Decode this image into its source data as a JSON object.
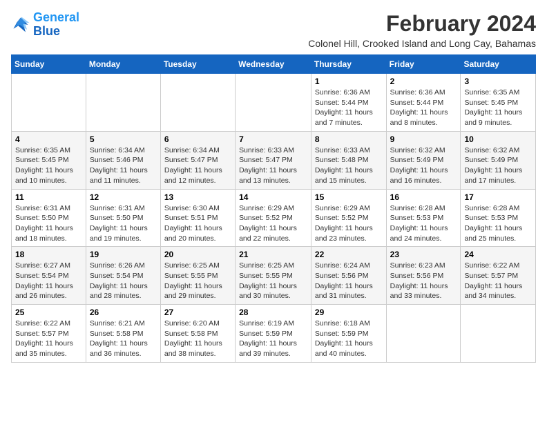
{
  "logo": {
    "line1": "General",
    "line2": "Blue"
  },
  "title": "February 2024",
  "subtitle": "Colonel Hill, Crooked Island and Long Cay, Bahamas",
  "days_of_week": [
    "Sunday",
    "Monday",
    "Tuesday",
    "Wednesday",
    "Thursday",
    "Friday",
    "Saturday"
  ],
  "weeks": [
    [
      {
        "day": "",
        "info": ""
      },
      {
        "day": "",
        "info": ""
      },
      {
        "day": "",
        "info": ""
      },
      {
        "day": "",
        "info": ""
      },
      {
        "day": "1",
        "info": "Sunrise: 6:36 AM\nSunset: 5:44 PM\nDaylight: 11 hours and 7 minutes."
      },
      {
        "day": "2",
        "info": "Sunrise: 6:36 AM\nSunset: 5:44 PM\nDaylight: 11 hours and 8 minutes."
      },
      {
        "day": "3",
        "info": "Sunrise: 6:35 AM\nSunset: 5:45 PM\nDaylight: 11 hours and 9 minutes."
      }
    ],
    [
      {
        "day": "4",
        "info": "Sunrise: 6:35 AM\nSunset: 5:45 PM\nDaylight: 11 hours and 10 minutes."
      },
      {
        "day": "5",
        "info": "Sunrise: 6:34 AM\nSunset: 5:46 PM\nDaylight: 11 hours and 11 minutes."
      },
      {
        "day": "6",
        "info": "Sunrise: 6:34 AM\nSunset: 5:47 PM\nDaylight: 11 hours and 12 minutes."
      },
      {
        "day": "7",
        "info": "Sunrise: 6:33 AM\nSunset: 5:47 PM\nDaylight: 11 hours and 13 minutes."
      },
      {
        "day": "8",
        "info": "Sunrise: 6:33 AM\nSunset: 5:48 PM\nDaylight: 11 hours and 15 minutes."
      },
      {
        "day": "9",
        "info": "Sunrise: 6:32 AM\nSunset: 5:49 PM\nDaylight: 11 hours and 16 minutes."
      },
      {
        "day": "10",
        "info": "Sunrise: 6:32 AM\nSunset: 5:49 PM\nDaylight: 11 hours and 17 minutes."
      }
    ],
    [
      {
        "day": "11",
        "info": "Sunrise: 6:31 AM\nSunset: 5:50 PM\nDaylight: 11 hours and 18 minutes."
      },
      {
        "day": "12",
        "info": "Sunrise: 6:31 AM\nSunset: 5:50 PM\nDaylight: 11 hours and 19 minutes."
      },
      {
        "day": "13",
        "info": "Sunrise: 6:30 AM\nSunset: 5:51 PM\nDaylight: 11 hours and 20 minutes."
      },
      {
        "day": "14",
        "info": "Sunrise: 6:29 AM\nSunset: 5:52 PM\nDaylight: 11 hours and 22 minutes."
      },
      {
        "day": "15",
        "info": "Sunrise: 6:29 AM\nSunset: 5:52 PM\nDaylight: 11 hours and 23 minutes."
      },
      {
        "day": "16",
        "info": "Sunrise: 6:28 AM\nSunset: 5:53 PM\nDaylight: 11 hours and 24 minutes."
      },
      {
        "day": "17",
        "info": "Sunrise: 6:28 AM\nSunset: 5:53 PM\nDaylight: 11 hours and 25 minutes."
      }
    ],
    [
      {
        "day": "18",
        "info": "Sunrise: 6:27 AM\nSunset: 5:54 PM\nDaylight: 11 hours and 26 minutes."
      },
      {
        "day": "19",
        "info": "Sunrise: 6:26 AM\nSunset: 5:54 PM\nDaylight: 11 hours and 28 minutes."
      },
      {
        "day": "20",
        "info": "Sunrise: 6:25 AM\nSunset: 5:55 PM\nDaylight: 11 hours and 29 minutes."
      },
      {
        "day": "21",
        "info": "Sunrise: 6:25 AM\nSunset: 5:55 PM\nDaylight: 11 hours and 30 minutes."
      },
      {
        "day": "22",
        "info": "Sunrise: 6:24 AM\nSunset: 5:56 PM\nDaylight: 11 hours and 31 minutes."
      },
      {
        "day": "23",
        "info": "Sunrise: 6:23 AM\nSunset: 5:56 PM\nDaylight: 11 hours and 33 minutes."
      },
      {
        "day": "24",
        "info": "Sunrise: 6:22 AM\nSunset: 5:57 PM\nDaylight: 11 hours and 34 minutes."
      }
    ],
    [
      {
        "day": "25",
        "info": "Sunrise: 6:22 AM\nSunset: 5:57 PM\nDaylight: 11 hours and 35 minutes."
      },
      {
        "day": "26",
        "info": "Sunrise: 6:21 AM\nSunset: 5:58 PM\nDaylight: 11 hours and 36 minutes."
      },
      {
        "day": "27",
        "info": "Sunrise: 6:20 AM\nSunset: 5:58 PM\nDaylight: 11 hours and 38 minutes."
      },
      {
        "day": "28",
        "info": "Sunrise: 6:19 AM\nSunset: 5:59 PM\nDaylight: 11 hours and 39 minutes."
      },
      {
        "day": "29",
        "info": "Sunrise: 6:18 AM\nSunset: 5:59 PM\nDaylight: 11 hours and 40 minutes."
      },
      {
        "day": "",
        "info": ""
      },
      {
        "day": "",
        "info": ""
      }
    ]
  ]
}
